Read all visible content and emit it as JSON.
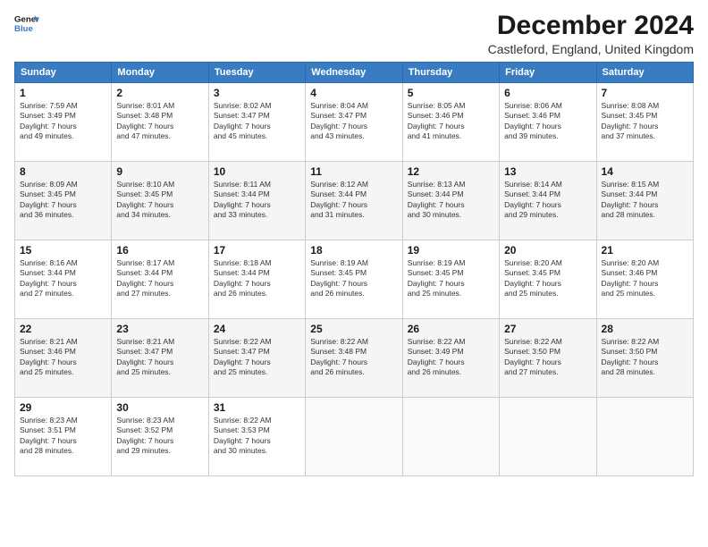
{
  "logo": {
    "line1": "General",
    "line2": "Blue",
    "arrow_color": "#3a7cc1"
  },
  "title": "December 2024",
  "subtitle": "Castleford, England, United Kingdom",
  "days_of_week": [
    "Sunday",
    "Monday",
    "Tuesday",
    "Wednesday",
    "Thursday",
    "Friday",
    "Saturday"
  ],
  "weeks": [
    [
      {
        "day": "1",
        "info": "Sunrise: 7:59 AM\nSunset: 3:49 PM\nDaylight: 7 hours\nand 49 minutes."
      },
      {
        "day": "2",
        "info": "Sunrise: 8:01 AM\nSunset: 3:48 PM\nDaylight: 7 hours\nand 47 minutes."
      },
      {
        "day": "3",
        "info": "Sunrise: 8:02 AM\nSunset: 3:47 PM\nDaylight: 7 hours\nand 45 minutes."
      },
      {
        "day": "4",
        "info": "Sunrise: 8:04 AM\nSunset: 3:47 PM\nDaylight: 7 hours\nand 43 minutes."
      },
      {
        "day": "5",
        "info": "Sunrise: 8:05 AM\nSunset: 3:46 PM\nDaylight: 7 hours\nand 41 minutes."
      },
      {
        "day": "6",
        "info": "Sunrise: 8:06 AM\nSunset: 3:46 PM\nDaylight: 7 hours\nand 39 minutes."
      },
      {
        "day": "7",
        "info": "Sunrise: 8:08 AM\nSunset: 3:45 PM\nDaylight: 7 hours\nand 37 minutes."
      }
    ],
    [
      {
        "day": "8",
        "info": "Sunrise: 8:09 AM\nSunset: 3:45 PM\nDaylight: 7 hours\nand 36 minutes."
      },
      {
        "day": "9",
        "info": "Sunrise: 8:10 AM\nSunset: 3:45 PM\nDaylight: 7 hours\nand 34 minutes."
      },
      {
        "day": "10",
        "info": "Sunrise: 8:11 AM\nSunset: 3:44 PM\nDaylight: 7 hours\nand 33 minutes."
      },
      {
        "day": "11",
        "info": "Sunrise: 8:12 AM\nSunset: 3:44 PM\nDaylight: 7 hours\nand 31 minutes."
      },
      {
        "day": "12",
        "info": "Sunrise: 8:13 AM\nSunset: 3:44 PM\nDaylight: 7 hours\nand 30 minutes."
      },
      {
        "day": "13",
        "info": "Sunrise: 8:14 AM\nSunset: 3:44 PM\nDaylight: 7 hours\nand 29 minutes."
      },
      {
        "day": "14",
        "info": "Sunrise: 8:15 AM\nSunset: 3:44 PM\nDaylight: 7 hours\nand 28 minutes."
      }
    ],
    [
      {
        "day": "15",
        "info": "Sunrise: 8:16 AM\nSunset: 3:44 PM\nDaylight: 7 hours\nand 27 minutes."
      },
      {
        "day": "16",
        "info": "Sunrise: 8:17 AM\nSunset: 3:44 PM\nDaylight: 7 hours\nand 27 minutes."
      },
      {
        "day": "17",
        "info": "Sunrise: 8:18 AM\nSunset: 3:44 PM\nDaylight: 7 hours\nand 26 minutes."
      },
      {
        "day": "18",
        "info": "Sunrise: 8:19 AM\nSunset: 3:45 PM\nDaylight: 7 hours\nand 26 minutes."
      },
      {
        "day": "19",
        "info": "Sunrise: 8:19 AM\nSunset: 3:45 PM\nDaylight: 7 hours\nand 25 minutes."
      },
      {
        "day": "20",
        "info": "Sunrise: 8:20 AM\nSunset: 3:45 PM\nDaylight: 7 hours\nand 25 minutes."
      },
      {
        "day": "21",
        "info": "Sunrise: 8:20 AM\nSunset: 3:46 PM\nDaylight: 7 hours\nand 25 minutes."
      }
    ],
    [
      {
        "day": "22",
        "info": "Sunrise: 8:21 AM\nSunset: 3:46 PM\nDaylight: 7 hours\nand 25 minutes."
      },
      {
        "day": "23",
        "info": "Sunrise: 8:21 AM\nSunset: 3:47 PM\nDaylight: 7 hours\nand 25 minutes."
      },
      {
        "day": "24",
        "info": "Sunrise: 8:22 AM\nSunset: 3:47 PM\nDaylight: 7 hours\nand 25 minutes."
      },
      {
        "day": "25",
        "info": "Sunrise: 8:22 AM\nSunset: 3:48 PM\nDaylight: 7 hours\nand 26 minutes."
      },
      {
        "day": "26",
        "info": "Sunrise: 8:22 AM\nSunset: 3:49 PM\nDaylight: 7 hours\nand 26 minutes."
      },
      {
        "day": "27",
        "info": "Sunrise: 8:22 AM\nSunset: 3:50 PM\nDaylight: 7 hours\nand 27 minutes."
      },
      {
        "day": "28",
        "info": "Sunrise: 8:22 AM\nSunset: 3:50 PM\nDaylight: 7 hours\nand 28 minutes."
      }
    ],
    [
      {
        "day": "29",
        "info": "Sunrise: 8:23 AM\nSunset: 3:51 PM\nDaylight: 7 hours\nand 28 minutes."
      },
      {
        "day": "30",
        "info": "Sunrise: 8:23 AM\nSunset: 3:52 PM\nDaylight: 7 hours\nand 29 minutes."
      },
      {
        "day": "31",
        "info": "Sunrise: 8:22 AM\nSunset: 3:53 PM\nDaylight: 7 hours\nand 30 minutes."
      },
      {
        "day": "",
        "info": ""
      },
      {
        "day": "",
        "info": ""
      },
      {
        "day": "",
        "info": ""
      },
      {
        "day": "",
        "info": ""
      }
    ]
  ]
}
